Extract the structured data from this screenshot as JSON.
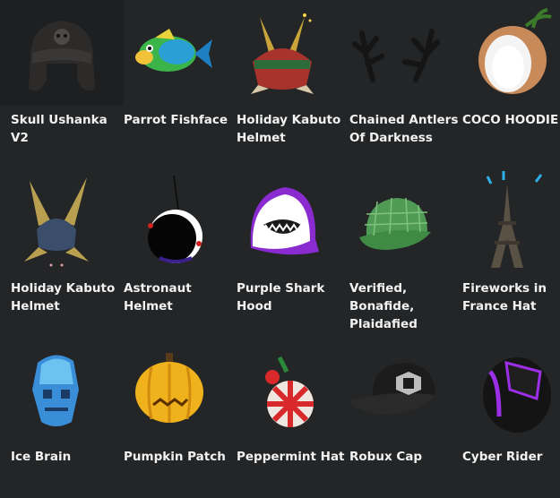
{
  "items": [
    {
      "name": "Skull Ushanka V2",
      "icon": "skull-ushanka-icon"
    },
    {
      "name": "Parrot Fishface",
      "icon": "parrot-fish-icon"
    },
    {
      "name": "Holiday Kabuto Helmet",
      "icon": "kabuto-helmet-icon"
    },
    {
      "name": "Chained Antlers Of Darkness",
      "icon": "antlers-icon"
    },
    {
      "name": "COCO HOODIE",
      "icon": "coconut-hood-icon"
    },
    {
      "name": "Holiday Kabuto Helmet",
      "icon": "kabuto-spiky-icon"
    },
    {
      "name": "Astronaut Helmet",
      "icon": "astronaut-helmet-icon"
    },
    {
      "name": "Purple Shark Hood",
      "icon": "shark-hood-icon"
    },
    {
      "name": "Verified, Bonafide, Plaidafied",
      "icon": "plaid-cap-icon"
    },
    {
      "name": "Fireworks in France Hat",
      "icon": "eiffel-tower-icon"
    },
    {
      "name": "Ice Brain",
      "icon": "ice-brain-icon"
    },
    {
      "name": "Pumpkin Patch",
      "icon": "pumpkin-icon"
    },
    {
      "name": "Peppermint Hat",
      "icon": "peppermint-hat-icon"
    },
    {
      "name": "Robux Cap",
      "icon": "robux-cap-icon"
    },
    {
      "name": "Cyber Rider",
      "icon": "cyber-helmet-icon"
    }
  ]
}
